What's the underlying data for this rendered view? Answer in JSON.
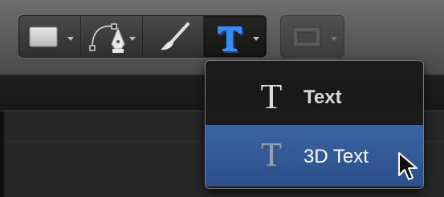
{
  "toolbar": {
    "tools": [
      {
        "name": "rectangle",
        "icon": "rectangle-icon",
        "has_menu": true
      },
      {
        "name": "bezier",
        "icon": "pen-icon",
        "has_menu": true
      },
      {
        "name": "paint",
        "icon": "brush-icon",
        "has_menu": false
      },
      {
        "name": "text",
        "icon": "text-tool-icon",
        "has_menu": true,
        "selected": true
      }
    ],
    "mask": {
      "icon": "mask-icon",
      "has_menu": true,
      "enabled": false
    }
  },
  "menu": {
    "items": [
      {
        "label": "Text",
        "icon": "text-icon",
        "highlighted": false
      },
      {
        "label": "3D Text",
        "icon": "3d-text-icon",
        "highlighted": true
      }
    ]
  },
  "colors": {
    "accent": "#2f5592",
    "selected_tool_icon": "#2f7de0"
  }
}
